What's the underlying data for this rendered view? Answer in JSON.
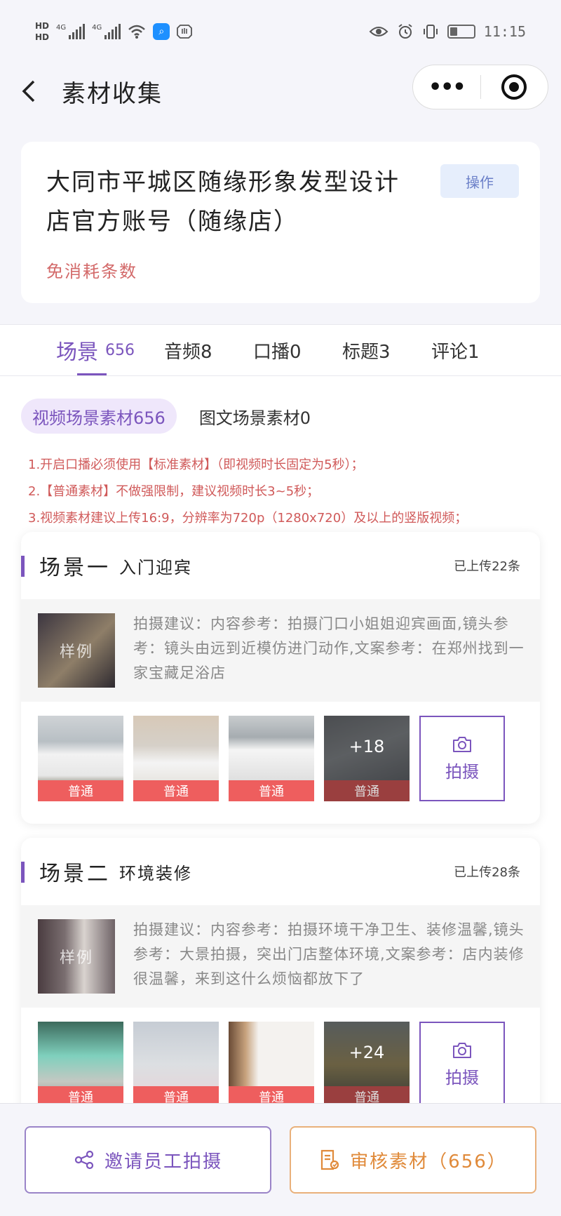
{
  "status_bar": {
    "hd1": "HD",
    "hd2": "HD",
    "net1": "4G",
    "net2": "4G",
    "time": "11:15"
  },
  "nav": {
    "back_icon": "chevron-left-icon",
    "title": "素材收集",
    "more_icon": "more-dots-icon",
    "target_icon": "record-target-icon"
  },
  "account": {
    "name": "大同市平城区随缘形象发型设计店官方账号（随缘店）",
    "action_label": "操作",
    "note": "免消耗条数"
  },
  "tabs": [
    {
      "label": "场景",
      "count": "656"
    },
    {
      "label": "音频8"
    },
    {
      "label": "口播0"
    },
    {
      "label": "标题3"
    },
    {
      "label": "评论1"
    }
  ],
  "subtabs": {
    "video": "视频场景素材656",
    "image": "图文场景素材0"
  },
  "notices": [
    "1.开启口播必须使用【标准素材】（即视频时长固定为5秒）；",
    "2.【普通素材】不做强限制，建议视频时长3~5秒；",
    "3.视频素材建议上传16:9，分辨率为720p（1280x720）及以上的竖版视频；"
  ],
  "scenes": [
    {
      "title": "场景一",
      "subtitle": "入门迎宾",
      "uploaded": "已上传22条",
      "sample_label": "样例",
      "tip": "拍摄建议：内容参考：拍摄门口小姐姐迎宾画面,镜头参考：镜头由远到近模仿进门动作,文案参考：在郑州找到一家宝藏足浴店",
      "thumbs": [
        {
          "tag": "普通"
        },
        {
          "tag": "普通"
        },
        {
          "tag": "普通"
        },
        {
          "tag": "普通",
          "more": "+18"
        }
      ],
      "shoot_label": "拍摄"
    },
    {
      "title": "场景二",
      "subtitle": "环境装修",
      "uploaded": "已上传28条",
      "sample_label": "样例",
      "tip": "拍摄建议：内容参考：拍摄环境干净卫生、装修温馨,镜头参考：大景拍摄，突出门店整体环境,文案参考：店内装修很温馨，来到这什么烦恼都放下了",
      "thumbs": [
        {
          "tag": "普通"
        },
        {
          "tag": "普通"
        },
        {
          "tag": "普通"
        },
        {
          "tag": "普通",
          "more": "+24"
        }
      ],
      "shoot_label": "拍摄"
    }
  ],
  "bottom": {
    "invite_label": "邀请员工拍摄",
    "review_label": "审核素材（656）"
  },
  "colors": {
    "accent": "#7b55bd",
    "tag_red": "#ee5e5e",
    "notice_red": "#d05a5a",
    "review_orange": "#e08a3a"
  }
}
